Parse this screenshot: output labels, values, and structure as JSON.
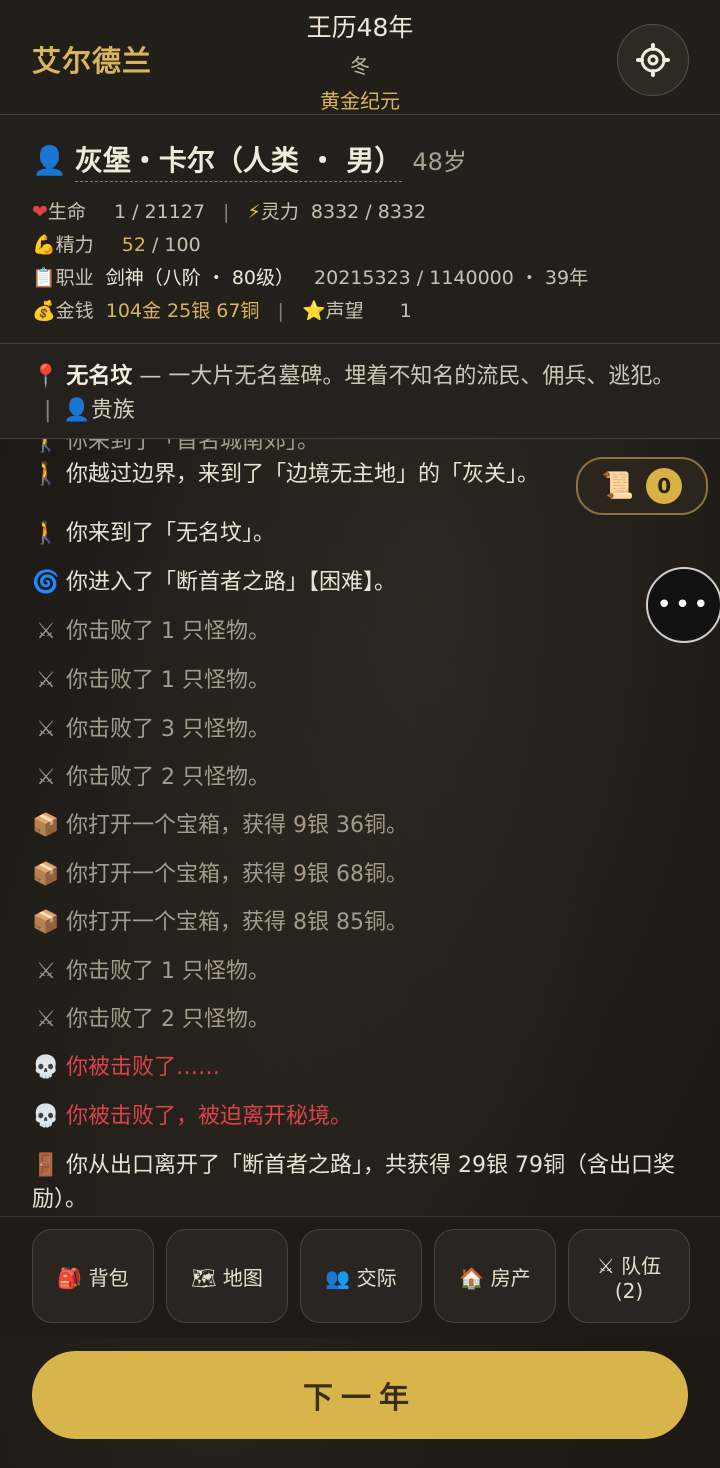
{
  "header": {
    "app_title": "艾尔德兰",
    "year": "王历48年",
    "season": "冬",
    "era": "黄金纪元",
    "settings_icon": "gear-icon"
  },
  "character": {
    "name": "灰堡・卡尔（人类 ・ 男）",
    "age": "48岁",
    "hp_label": "生命",
    "hp_value": "1 / 21127",
    "mana_label": "灵力",
    "mana_value": "8332 / 8332",
    "stamina_label": "精力",
    "stamina_value": "52",
    "stamina_max": "/ 100",
    "class_label": "职业",
    "class_value": "剑神（八阶 ・ 80级）",
    "exp_value": "20215323 / 1140000 ・ 39年",
    "money_label": "金钱",
    "money_value": "104金 25银 67铜",
    "fame_label": "声望",
    "fame_value": "1"
  },
  "location": {
    "name": "无名坟",
    "description": " — 一大片无名墓碑。埋着不知名的流民、佣兵、逃犯。",
    "rank": "贵族"
  },
  "log": [
    {
      "icon": "walk-icon",
      "text": "你越过边界，来到了「边境无主地」的「灰关」。",
      "tone": "normal"
    },
    {
      "icon": "walk-icon",
      "text": "你来到了「无名坟」。",
      "tone": "normal"
    },
    {
      "icon": "portal-icon",
      "text": "你进入了「断首者之路」【困难】。",
      "tone": "normal"
    },
    {
      "icon": "swords-icon",
      "text": "你击败了 1 只怪物。",
      "tone": "muted"
    },
    {
      "icon": "swords-icon",
      "text": "你击败了 1 只怪物。",
      "tone": "muted"
    },
    {
      "icon": "swords-icon",
      "text": "你击败了 3 只怪物。",
      "tone": "muted"
    },
    {
      "icon": "swords-icon",
      "text": "你击败了 2 只怪物。",
      "tone": "muted"
    },
    {
      "icon": "chest-icon",
      "text": "你打开一个宝箱，获得 9银 36铜。",
      "tone": "muted"
    },
    {
      "icon": "chest-icon",
      "text": "你打开一个宝箱，获得 9银 68铜。",
      "tone": "muted"
    },
    {
      "icon": "chest-icon",
      "text": "你打开一个宝箱，获得 8银 85铜。",
      "tone": "muted"
    },
    {
      "icon": "swords-icon",
      "text": "你击败了 1 只怪物。",
      "tone": "muted"
    },
    {
      "icon": "swords-icon",
      "text": "你击败了 2 只怪物。",
      "tone": "muted"
    },
    {
      "icon": "skull-icon",
      "text": "你被击败了……",
      "tone": "red"
    },
    {
      "icon": "skull-icon",
      "text": "你被击败了，被迫离开秘境。",
      "tone": "red"
    },
    {
      "icon": "door-icon",
      "text": "你从出口离开了「断首者之路」，共获得 29银 79铜（含出口奖励）。",
      "tone": "normal"
    }
  ],
  "log_partial": "你来到了「首名城南郊」。",
  "scroll_badge": {
    "count": "0",
    "icon": "scroll-icon"
  },
  "nav": [
    {
      "icon": "backpack-icon",
      "label": "背包"
    },
    {
      "icon": "map-icon",
      "label": "地图"
    },
    {
      "icon": "people-icon",
      "label": "交际"
    },
    {
      "icon": "house-icon",
      "label": "房产"
    },
    {
      "icon": "swords-icon",
      "label": "队伍",
      "sub": "(2)"
    }
  ],
  "next_button": "下一年"
}
